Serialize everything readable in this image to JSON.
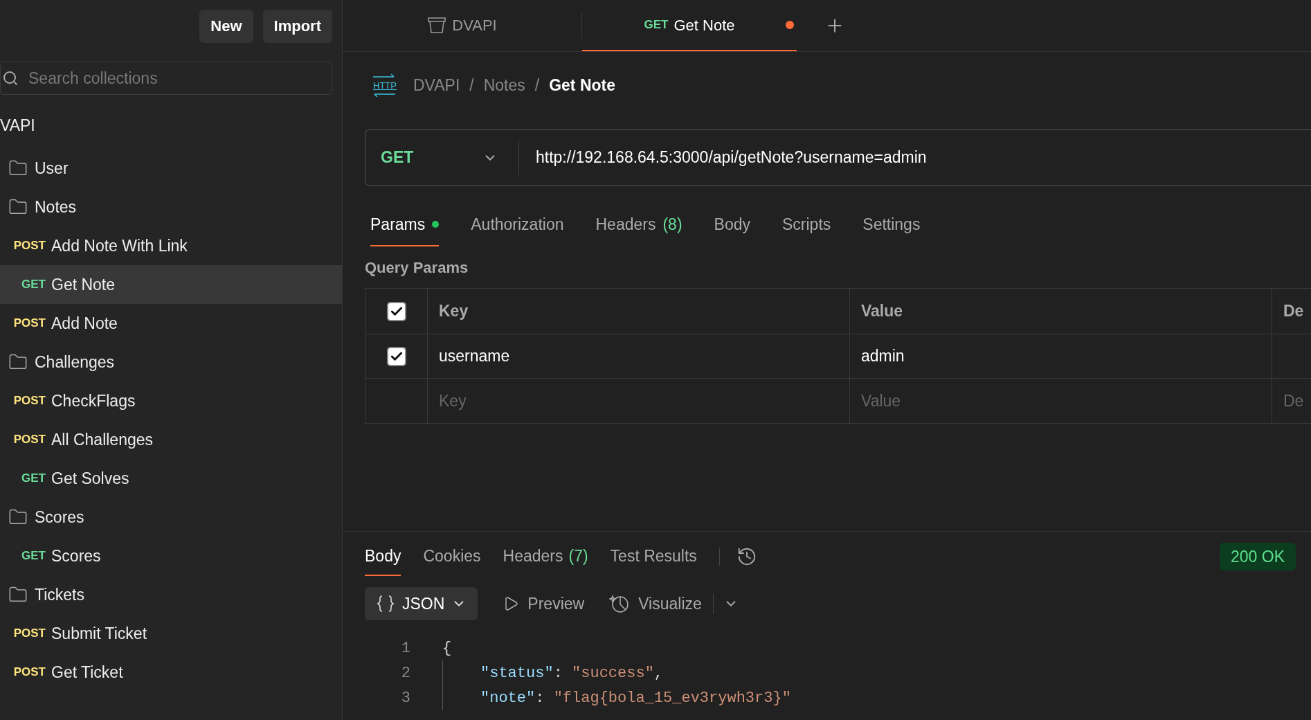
{
  "top_buttons": [
    {
      "label": "New"
    },
    {
      "label": "Import"
    }
  ],
  "sidebar": {
    "search": {
      "placeholder": "Search collections"
    },
    "collection": "VAPI",
    "items": [
      {
        "kind": "folder",
        "name": "User",
        "selected": false
      },
      {
        "kind": "folder",
        "name": "Notes",
        "selected": false,
        "children": [
          {
            "kind": "request",
            "method": "POST",
            "name": "Add Note With Link",
            "selected": false
          },
          {
            "kind": "request",
            "method": "GET",
            "name": "Get Note",
            "selected": true
          },
          {
            "kind": "request",
            "method": "POST",
            "name": "Add Note",
            "selected": false
          }
        ]
      },
      {
        "kind": "folder",
        "name": "Challenges",
        "selected": false,
        "children": [
          {
            "kind": "request",
            "method": "POST",
            "name": "CheckFlags",
            "selected": false
          },
          {
            "kind": "request",
            "method": "POST",
            "name": "All Challenges",
            "selected": false
          },
          {
            "kind": "request",
            "method": "GET",
            "name": "Get Solves",
            "selected": false
          }
        ]
      },
      {
        "kind": "folder",
        "name": "Scores",
        "selected": false,
        "children": [
          {
            "kind": "request",
            "method": "GET",
            "name": "Scores",
            "selected": false
          }
        ]
      },
      {
        "kind": "folder",
        "name": "Tickets",
        "selected": false,
        "children": [
          {
            "kind": "request",
            "method": "POST",
            "name": "Submit Ticket",
            "selected": false
          },
          {
            "kind": "request",
            "method": "POST",
            "name": "Get Ticket",
            "selected": false
          }
        ]
      }
    ]
  },
  "tabs": [
    {
      "kind": "collection",
      "label": "DVAPI",
      "selected": false,
      "unsaved": false
    },
    {
      "kind": "request",
      "method": "GET",
      "label": "Get Note",
      "selected": true,
      "unsaved": true
    }
  ],
  "breadcrumb": {
    "icon_label": "HTTP",
    "separator": "/",
    "parts": [
      "DVAPI",
      "Notes",
      "Get Note"
    ]
  },
  "request": {
    "method": "GET",
    "url": "http://192.168.64.5:3000/api/getNote?username=admin"
  },
  "request_tabs": [
    {
      "label": "Params",
      "selected": true,
      "indicator": true
    },
    {
      "label": "Authorization",
      "selected": false,
      "indicator": false
    },
    {
      "label": "Headers",
      "count": "(8)",
      "selected": false,
      "indicator": false
    },
    {
      "label": "Body",
      "selected": false,
      "indicator": false
    },
    {
      "label": "Scripts",
      "selected": false,
      "indicator": false
    },
    {
      "label": "Settings",
      "selected": false,
      "indicator": false
    }
  ],
  "query_params": {
    "title": "Query Params",
    "columns": [
      "Key",
      "Value",
      "De"
    ],
    "header_checked": true,
    "rows": [
      {
        "checked": true,
        "key": "username",
        "value": "admin"
      }
    ],
    "new_row": {
      "key_placeholder": "Key",
      "value_placeholder": "Value",
      "description_placeholder": "De"
    }
  },
  "response": {
    "tabs": [
      {
        "label": "Body",
        "selected": true
      },
      {
        "label": "Cookies",
        "selected": false
      },
      {
        "label": "Headers",
        "count": "(7)",
        "selected": false
      },
      {
        "label": "Test Results",
        "selected": false
      }
    ],
    "status": "200 OK",
    "format": "JSON",
    "views": [
      {
        "kind": "preview",
        "label": "Preview"
      },
      {
        "kind": "visualize",
        "label": "Visualize"
      }
    ],
    "code_lines": [
      {
        "number": "1",
        "indent": false,
        "tokens": [
          {
            "kind": "punct",
            "text": "{"
          }
        ]
      },
      {
        "number": "2",
        "indent": true,
        "tokens": [
          {
            "kind": "key",
            "text": "\"status\""
          },
          {
            "kind": "punct",
            "text": ": "
          },
          {
            "kind": "string",
            "text": "\"success\""
          },
          {
            "kind": "punct",
            "text": ","
          }
        ]
      },
      {
        "number": "3",
        "indent": true,
        "tokens": [
          {
            "kind": "key",
            "text": "\"note\""
          },
          {
            "kind": "punct",
            "text": ": "
          },
          {
            "kind": "string",
            "text": "\"flag{bola_15_ev3rywh3r3}\""
          }
        ]
      }
    ]
  }
}
